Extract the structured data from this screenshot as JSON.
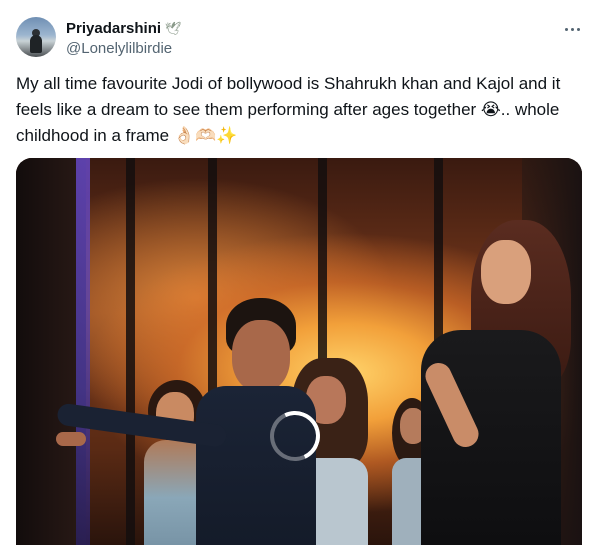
{
  "tweet": {
    "author": {
      "display_name": "Priyadarshini",
      "name_emoji_icon": "dove-icon",
      "handle": "@Lonelylilbirdie"
    },
    "more_icon": "ellipsis-icon",
    "text": "My all time favourite Jodi of bollywood is Shahrukh khan and Kajol and it feels like a dream to see them performing after ages together 😭.. whole childhood in a frame 👌🏻🫶🏻✨",
    "media": {
      "type": "video",
      "state": "loading",
      "loading_icon": "spinner-icon"
    }
  }
}
